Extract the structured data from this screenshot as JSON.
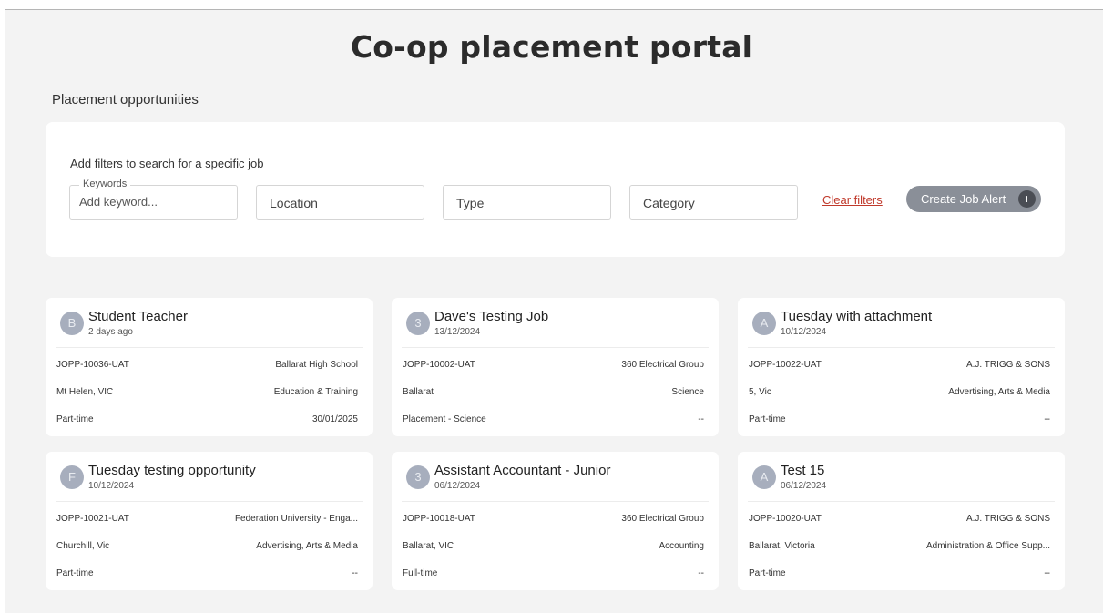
{
  "page": {
    "title": "Co-op placement portal",
    "subtitle": "Placement opportunities"
  },
  "filters": {
    "hint": "Add filters to search for a specific job",
    "keywords_legend": "Keywords",
    "keywords_placeholder": "Add keyword...",
    "location_label": "Location",
    "type_label": "Type",
    "category_label": "Category",
    "clear_label": "Clear filters",
    "alert_label": "Create Job Alert",
    "alert_icon": "+"
  },
  "colors": {
    "accent_link": "#c0392b",
    "button_bg": "#8a8f98",
    "avatar_bg": "#a7aebd"
  },
  "jobs": [
    {
      "initial": "B",
      "title": "Student Teacher",
      "date": "2 days ago",
      "id": "JOPP-10036-UAT",
      "employer": "Ballarat High School",
      "location": "Mt Helen, VIC",
      "category": "Education & Training",
      "type": "Part-time",
      "closing": "30/01/2025"
    },
    {
      "initial": "3",
      "title": "Dave's Testing Job",
      "date": "13/12/2024",
      "id": "JOPP-10002-UAT",
      "employer": "360 Electrical Group",
      "location": "Ballarat",
      "category": "Science",
      "type": "Placement - Science",
      "closing": "--"
    },
    {
      "initial": "A",
      "title": "Tuesday with attachment",
      "date": "10/12/2024",
      "id": "JOPP-10022-UAT",
      "employer": "A.J. TRIGG & SONS",
      "location": "5, Vic",
      "category": "Advertising, Arts & Media",
      "type": "Part-time",
      "closing": "--"
    },
    {
      "initial": "F",
      "title": "Tuesday testing opportunity",
      "date": "10/12/2024",
      "id": "JOPP-10021-UAT",
      "employer": "Federation University - Enga...",
      "location": "Churchill, Vic",
      "category": "Advertising, Arts & Media",
      "type": "Part-time",
      "closing": "--"
    },
    {
      "initial": "3",
      "title": "Assistant Accountant - Junior",
      "date": "06/12/2024",
      "id": "JOPP-10018-UAT",
      "employer": "360 Electrical Group",
      "location": "Ballarat, VIC",
      "category": "Accounting",
      "type": "Full-time",
      "closing": "--"
    },
    {
      "initial": "A",
      "title": "Test 15",
      "date": "06/12/2024",
      "id": "JOPP-10020-UAT",
      "employer": "A.J. TRIGG & SONS",
      "location": "Ballarat, Victoria",
      "category": "Administration & Office Supp...",
      "type": "Part-time",
      "closing": "--"
    }
  ]
}
